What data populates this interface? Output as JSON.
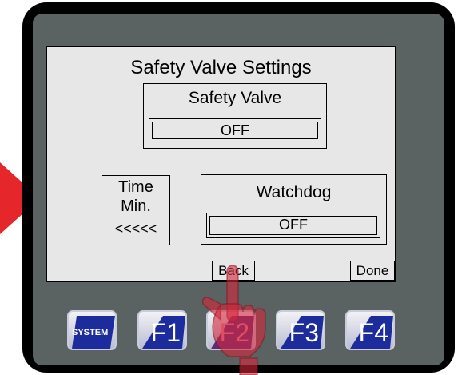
{
  "screen": {
    "title": "Safety Valve Settings",
    "safety_valve": {
      "label": "Safety Valve",
      "value": "OFF"
    },
    "time_box": {
      "line1": "Time",
      "line2": "Min.",
      "line3": "<<<<<"
    },
    "watchdog": {
      "label": "Watchdog",
      "value": "OFF"
    },
    "back_label": "Back",
    "done_label": "Done"
  },
  "function_keys": [
    {
      "label": "SYSTEM",
      "highlighted": false
    },
    {
      "label": "F1",
      "highlighted": false
    },
    {
      "label": "F2",
      "highlighted": true
    },
    {
      "label": "F3",
      "highlighted": false
    },
    {
      "label": "F4",
      "highlighted": false
    }
  ],
  "colors": {
    "bezel": "#000000",
    "panel": "#5a6361",
    "screen": "#e7e7e7",
    "key_blue": "#1d2c9c",
    "pointer_red": "#e5262b"
  }
}
